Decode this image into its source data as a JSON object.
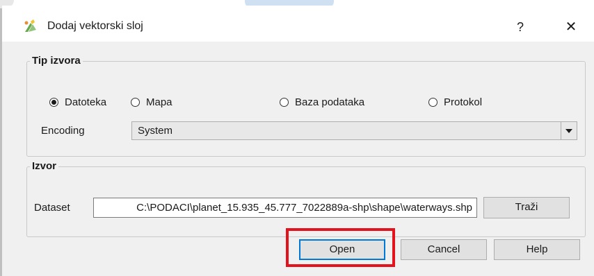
{
  "window": {
    "title": "Dodaj vektorski sloj",
    "help_glyph": "?",
    "close_glyph": "✕",
    "icon": "qgis-icon"
  },
  "source_type": {
    "title": "Tip izvora",
    "options": [
      {
        "label": "Datoteka",
        "checked": true
      },
      {
        "label": "Mapa",
        "checked": false
      },
      {
        "label": "Baza podataka",
        "checked": false
      },
      {
        "label": "Protokol",
        "checked": false
      }
    ],
    "encoding_label": "Encoding",
    "encoding_value": "System"
  },
  "source": {
    "title": "Izvor",
    "dataset_label": "Dataset",
    "dataset_value": "C:\\PODACI\\planet_15.935_45.777_7022889a-shp\\shape\\waterways.shp",
    "browse_label": "Traži"
  },
  "buttons": {
    "open": "Open",
    "cancel": "Cancel",
    "help": "Help"
  },
  "colors": {
    "highlight": "#e3121c",
    "focus": "#0078d7"
  }
}
